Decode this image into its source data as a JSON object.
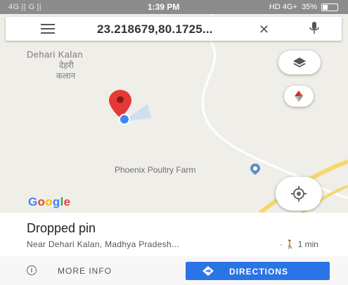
{
  "status_bar": {
    "left": "4G || G ||",
    "time": "1:39 PM",
    "network": "HD 4G+",
    "battery": "35%"
  },
  "search": {
    "query": "23.218679,80.1725..."
  },
  "map": {
    "place_name_en": "Dehari Kalan",
    "place_name_hi_1": "देहरी",
    "place_name_hi_2": "कलान",
    "poi_label": "Phoenix Poultry Farm",
    "logo": [
      "G",
      "o",
      "o",
      "g",
      "l",
      "e"
    ]
  },
  "sheet": {
    "title": "Dropped pin",
    "subtitle": "Near Dehari Kalan, Madhya Pradesh...",
    "walk_time": "1 min",
    "more_info_label": "MORE INFO",
    "directions_label": "DIRECTIONS"
  },
  "colors": {
    "accent": "#2b74e6",
    "pin": "#e53935",
    "road_yellow": "#f5d76e"
  }
}
